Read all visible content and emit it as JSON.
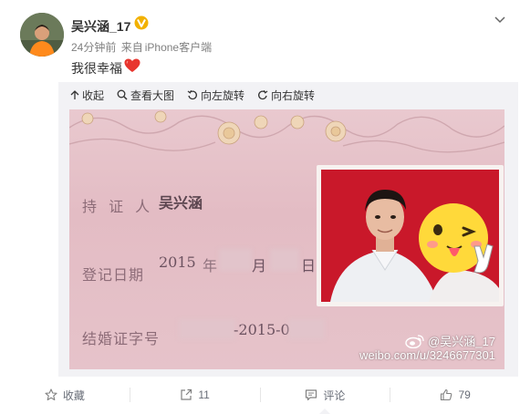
{
  "post": {
    "username": "吴兴涵_17",
    "time": "24分钟前",
    "source_prefix": "来自",
    "source": "iPhone客户端",
    "text": "我很幸福"
  },
  "media_toolbar": {
    "collapse": "收起",
    "view_large": "查看大图",
    "rotate_left": "向左旋转",
    "rotate_right": "向右旋转"
  },
  "photo": {
    "holder_label": "持 证 人",
    "holder_name": "吴兴涵",
    "date_label": "登记日期",
    "date_year": "2015",
    "date_year_unit": "年",
    "date_month_unit": "月",
    "date_day_unit": "日",
    "cert_label": "结婚证字号",
    "cert_mid": "-2015-0",
    "watermark_handle": "@吴兴涵_17",
    "watermark_url": "weibo.com/u/3246677301"
  },
  "footer": {
    "favorite": "收藏",
    "repost_count": "11",
    "comment": "评论",
    "like_count": "79"
  },
  "colors": {
    "accent_orange": "#ff8200",
    "heart_red": "#e8352e",
    "vip_gold": "#f2b100",
    "certificate_pink": "#e6c3ca",
    "portrait_red": "#c9182a"
  }
}
